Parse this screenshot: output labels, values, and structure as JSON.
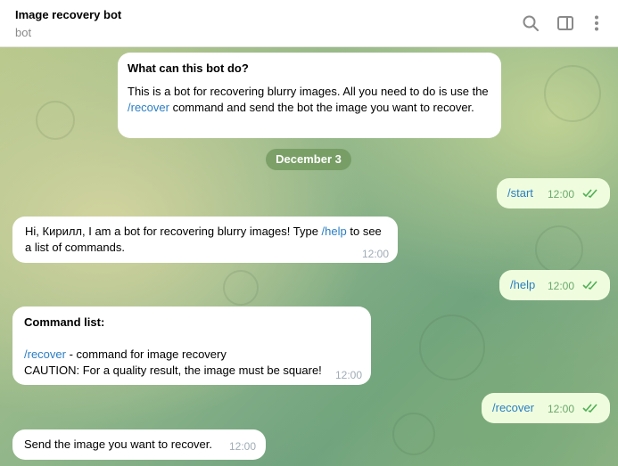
{
  "header": {
    "title": "Image recovery bot",
    "subtitle": "bot",
    "icons": [
      "search-icon",
      "sidebar-toggle-icon",
      "more-vertical-icon"
    ]
  },
  "colors": {
    "link": "#2a7ec4",
    "outgoing_bubble": "#effdde",
    "incoming_bubble": "#ffffff",
    "check": "#4faf55"
  },
  "intro": {
    "heading": "What can this bot do?",
    "text_before": "This is a bot for recovering blurry images. All you need to do is use the ",
    "command": "/recover",
    "text_after": " command and send the bot the image you want to recover."
  },
  "date_separator": "December 3",
  "messages": [
    {
      "dir": "out",
      "text": "/start",
      "time": "12:00"
    },
    {
      "dir": "in",
      "text_before": "Hi, Кирилл, I am a bot for recovering blurry images! Type ",
      "command": "/help",
      "text_after": " to see a list of commands.",
      "time": "12:00"
    },
    {
      "dir": "out",
      "text": "/help",
      "time": "12:00"
    },
    {
      "dir": "in",
      "heading": "Command list:",
      "command": "/recover",
      "line1_after": " - command for image recovery",
      "line2": "CAUTION: For a quality result, the image must be square!",
      "time": "12:00"
    },
    {
      "dir": "out",
      "text": "/recover",
      "time": "12:00"
    },
    {
      "dir": "in",
      "text": "Send the image you want to recover.",
      "time": "12:00"
    }
  ]
}
